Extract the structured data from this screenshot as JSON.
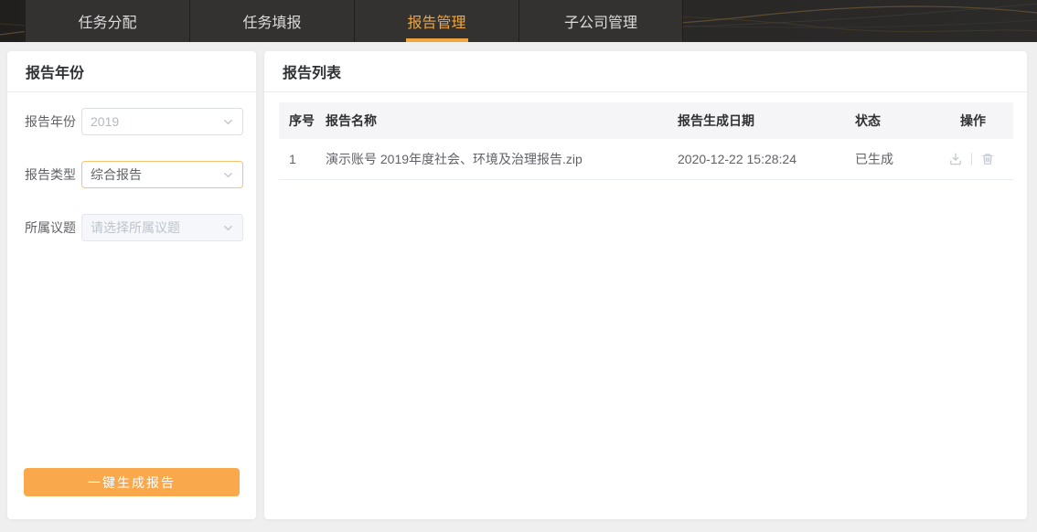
{
  "nav": {
    "tabs": [
      {
        "label": "任务分配",
        "active": false
      },
      {
        "label": "任务填报",
        "active": false
      },
      {
        "label": "报告管理",
        "active": true
      },
      {
        "label": "子公司管理",
        "active": false
      }
    ]
  },
  "left_panel": {
    "title": "报告年份",
    "fields": [
      {
        "label": "报告年份",
        "value": "2019",
        "state": "readonly"
      },
      {
        "label": "报告类型",
        "value": "综合报告",
        "state": "focused"
      },
      {
        "label": "所属议题",
        "value": "请选择所属议题",
        "state": "disabled",
        "is_placeholder": true
      }
    ],
    "generate_button_label": "一键生成报告"
  },
  "right_panel": {
    "title": "报告列表",
    "table": {
      "columns": {
        "index": "序号",
        "name": "报告名称",
        "date": "报告生成日期",
        "status": "状态",
        "actions": "操作"
      },
      "rows": [
        {
          "index": "1",
          "name": "演示账号 2019年度社会、环境及治理报告.zip",
          "date": "2020-12-22 15:28:24",
          "status": "已生成",
          "actions": [
            "download",
            "delete"
          ]
        }
      ]
    }
  },
  "colors": {
    "accent_orange": "#f0a63c",
    "button_orange": "#f9a84b",
    "focused_border_orange": "#f8c170",
    "nav_background": "#262524",
    "page_background": "#efefef",
    "table_header_bg": "#f5f5f7",
    "muted_icon": "#c3c7cf"
  }
}
